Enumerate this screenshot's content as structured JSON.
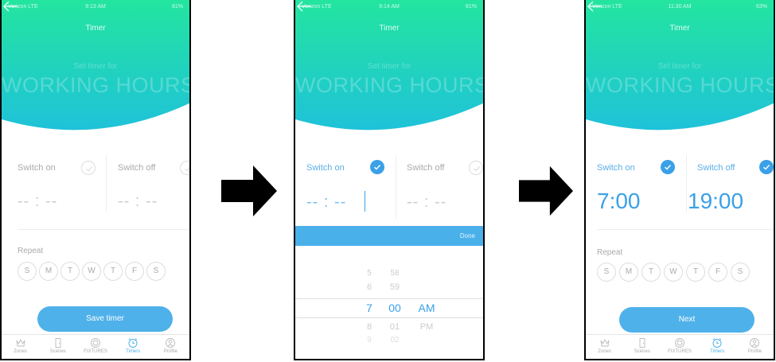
{
  "colors": {
    "accent": "#4fb1ea",
    "accent_check": "#3aa0e8",
    "hero_top": "#23e59f",
    "hero_bottom": "#1fc2d9"
  },
  "screens": [
    {
      "status": {
        "carrier": "Verizon  LTE",
        "time": "9:13 AM",
        "battery": "81%"
      },
      "nav_title": "Timer",
      "hero": {
        "subtitle": "Set timer for",
        "title": "WORKING HOURS"
      },
      "switch_on": {
        "label": "Switch on",
        "value": "-- : --",
        "checked": false
      },
      "switch_off": {
        "label": "Switch off",
        "value": "-- : --",
        "checked": false
      },
      "repeat": {
        "label": "Repeat",
        "days": [
          "S",
          "M",
          "T",
          "W",
          "T",
          "F",
          "S"
        ]
      },
      "primary_button": "Save timer",
      "tabs": [
        {
          "label": "Zones",
          "icon": "crown-icon"
        },
        {
          "label": "Scenes",
          "icon": "door-icon"
        },
        {
          "label": "FIXTURES",
          "icon": "bulb-icon"
        },
        {
          "label": "Timers",
          "icon": "alarm-clock-icon",
          "active": true
        },
        {
          "label": "Profile",
          "icon": "profile-icon"
        }
      ]
    },
    {
      "status": {
        "carrier": "Verizon  LTE",
        "time": "9:14 AM",
        "battery": "81%"
      },
      "nav_title": "Timer",
      "hero": {
        "subtitle": "Set timer for",
        "title": "WORKING HOURS"
      },
      "switch_on": {
        "label": "Switch on",
        "value": "-- : --",
        "checked": true
      },
      "switch_off": {
        "label": "Switch off",
        "value": "-- : --",
        "checked": false
      },
      "picker": {
        "done_label": "Done",
        "hours": [
          "5",
          "6",
          "7",
          "8",
          "9"
        ],
        "minutes": [
          "58",
          "59",
          "00",
          "01",
          "02"
        ],
        "periods": [
          "AM",
          "PM"
        ],
        "selected": {
          "hour": "7",
          "minute": "00",
          "period": "AM"
        }
      }
    },
    {
      "status": {
        "carrier": "Verizon  LTE",
        "time": "11:30 AM",
        "battery": "63%"
      },
      "nav_title": "Timer",
      "hero": {
        "subtitle": "Set timer for",
        "title": "WORKING HOURS"
      },
      "switch_on": {
        "label": "Switch on",
        "value": "7:00",
        "checked": true
      },
      "switch_off": {
        "label": "Switch off",
        "value": "19:00",
        "checked": true
      },
      "repeat": {
        "label": "Repeat",
        "days": [
          "S",
          "M",
          "T",
          "W",
          "T",
          "F",
          "S"
        ]
      },
      "primary_button": "Next",
      "tabs": [
        {
          "label": "Zones",
          "icon": "crown-icon"
        },
        {
          "label": "Scenes",
          "icon": "door-icon"
        },
        {
          "label": "FIXTURES",
          "icon": "bulb-icon"
        },
        {
          "label": "Timers",
          "icon": "alarm-clock-icon",
          "active": true
        },
        {
          "label": "Profile",
          "icon": "profile-icon"
        }
      ]
    }
  ]
}
